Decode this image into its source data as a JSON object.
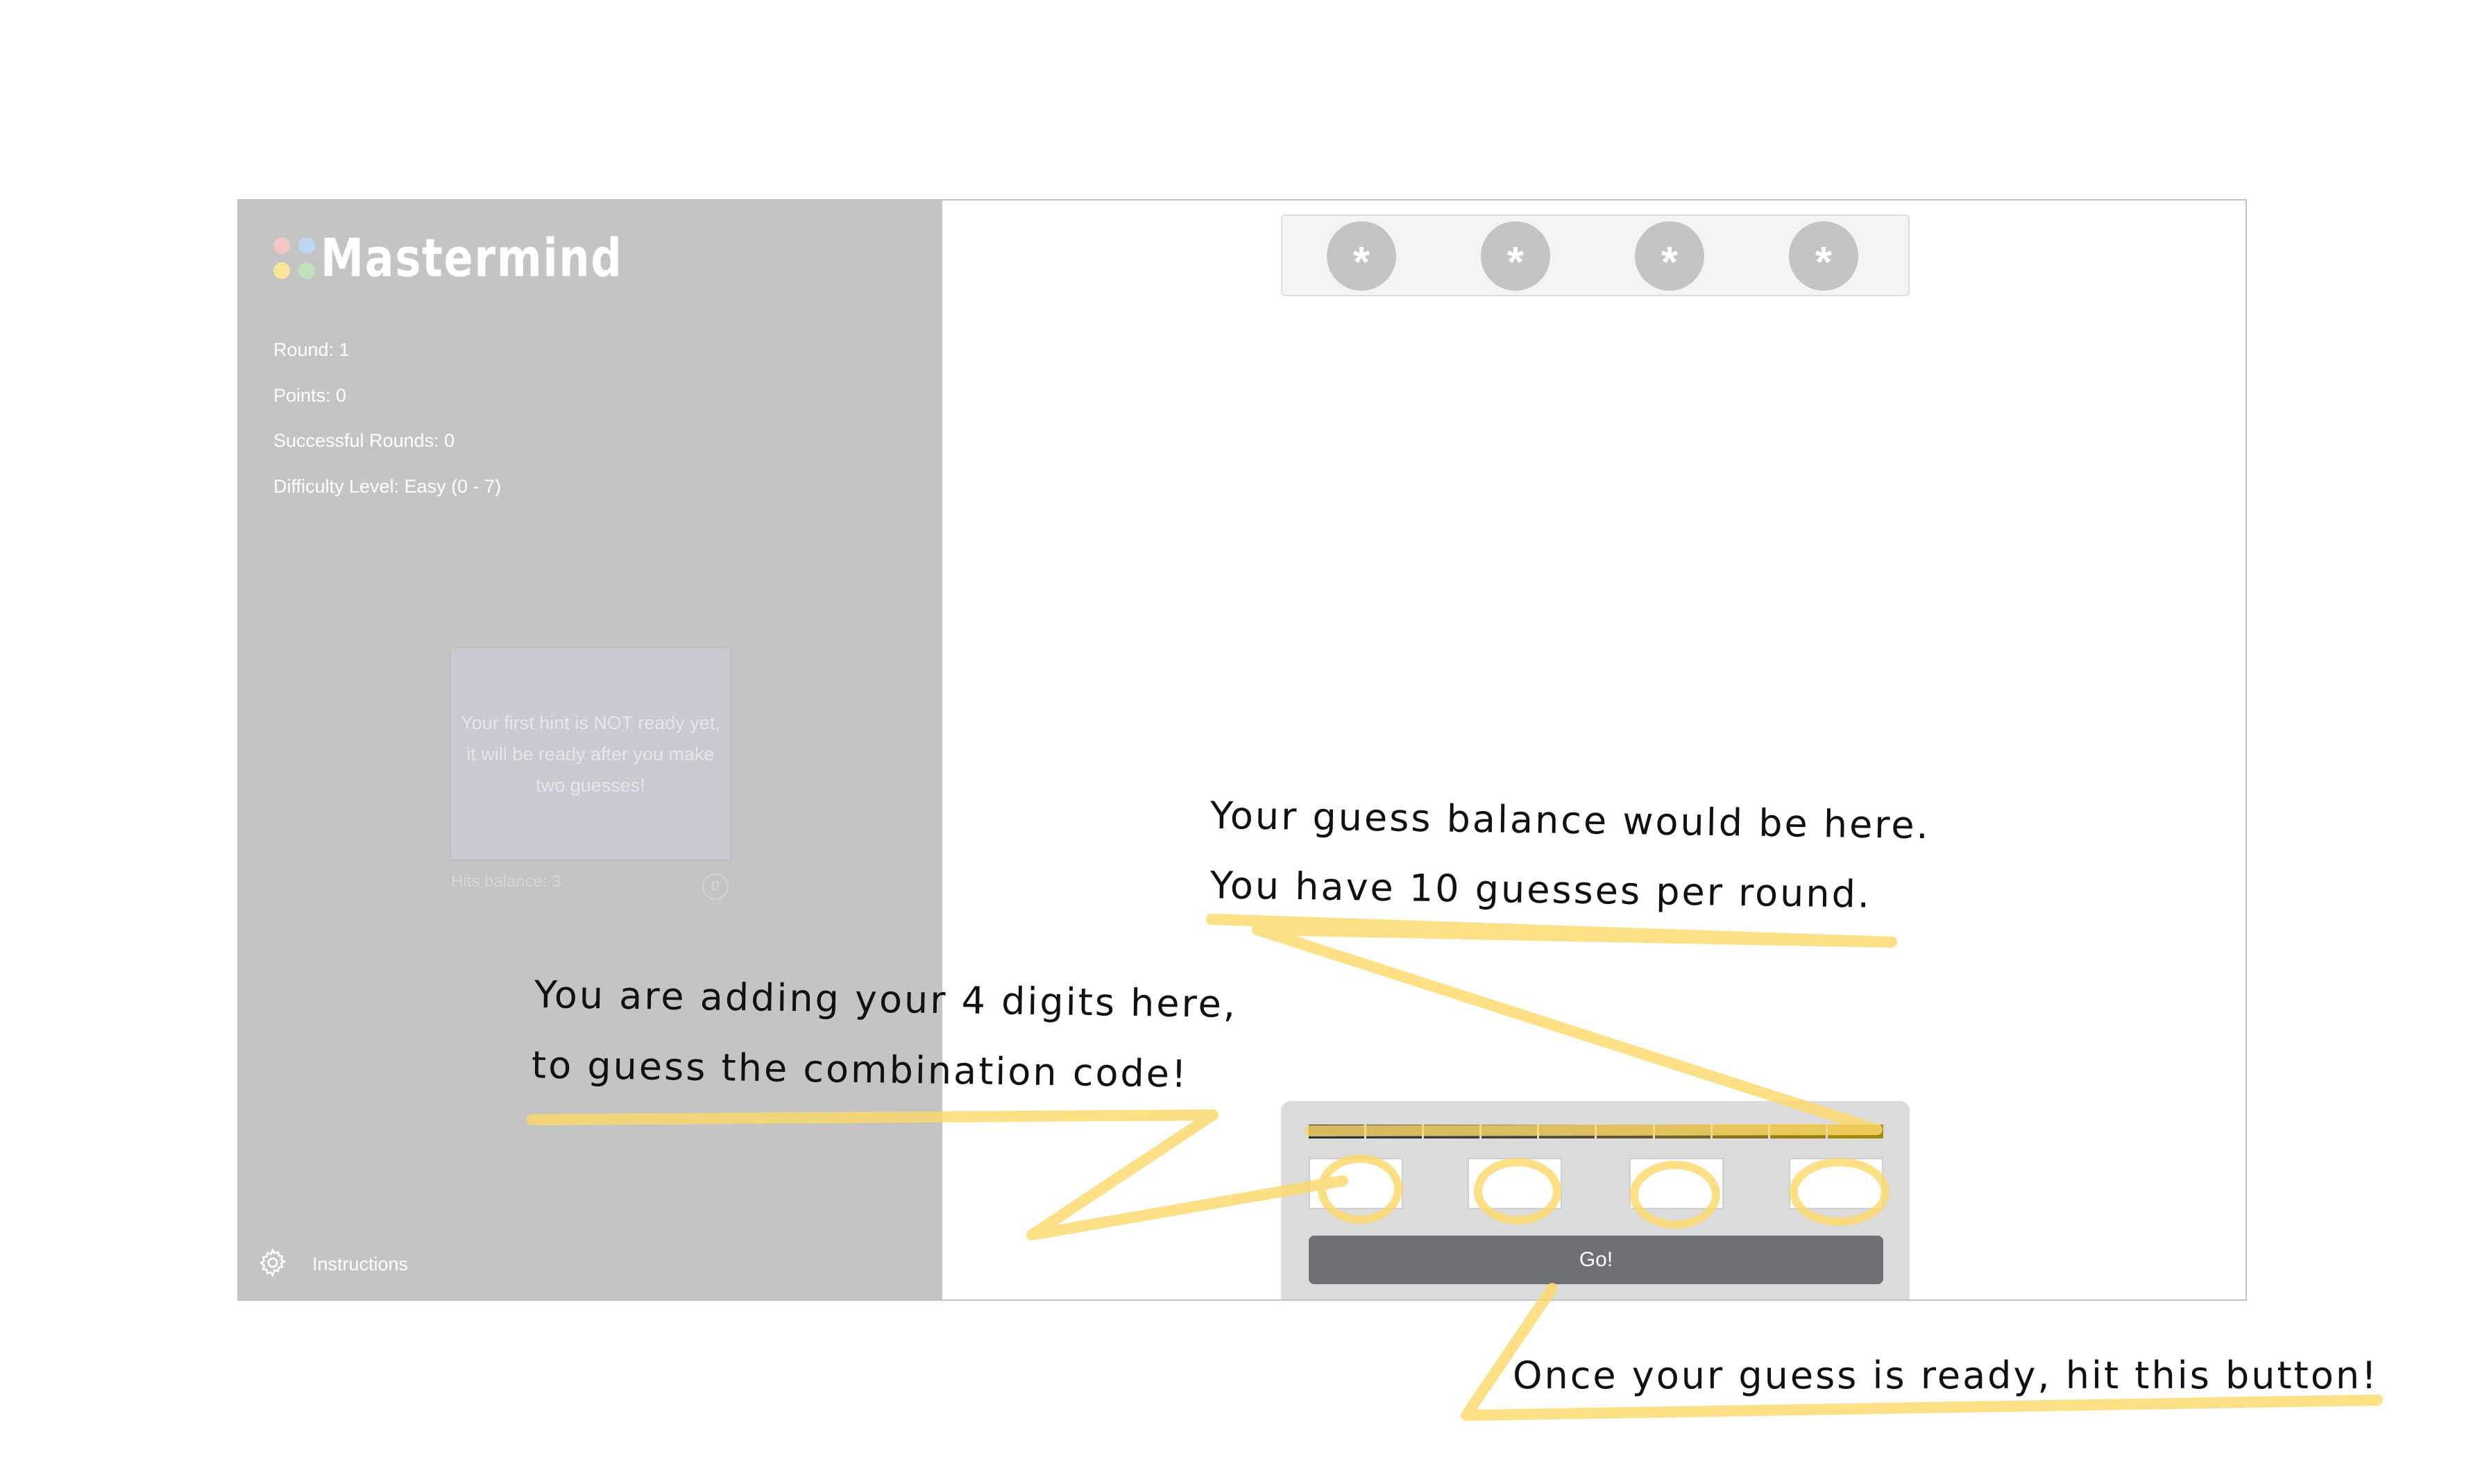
{
  "app": {
    "title": "Mastermind",
    "logo_dot_colors": [
      "#f4c6c6",
      "#bcd6f4",
      "#fbe59a",
      "#bfe3bf"
    ]
  },
  "sidebar": {
    "stats": [
      "Round: 1",
      "Points: 0",
      "Successful Rounds: 0",
      "Difficulty Level: Easy (0 - 7)"
    ],
    "hint_text": "Your first hint is NOT ready yet, it will be ready after you make two guesses!",
    "hits_balance": "Hits balance: 3",
    "hits_count": "0",
    "instructions_label": "Instructions",
    "settings_icon": "gear-icon"
  },
  "secret_code": {
    "slots": [
      "*",
      "*",
      "*",
      "*"
    ]
  },
  "guess_panel": {
    "balance_bar": {
      "segment_count": 10,
      "segment_colors": [
        "#2e3134",
        "#33363a",
        "#3b3d3f",
        "#44433c",
        "#4f4c38",
        "#5e5731",
        "#716527",
        "#87751e",
        "#987f13",
        "#a68a0b"
      ]
    },
    "digit_inputs": [
      "",
      "",
      "",
      ""
    ],
    "go_label": "Go!"
  },
  "annotations": {
    "balance_line1": "Your guess balance would be here.",
    "balance_line2": "You have 10 guesses per round.",
    "digits_line1": "You are adding your 4 digits here,",
    "digits_line2": "to guess the combination code!",
    "button_line": "Once your guess is ready, hit this button!",
    "highlight_color": "#fcd86a"
  }
}
